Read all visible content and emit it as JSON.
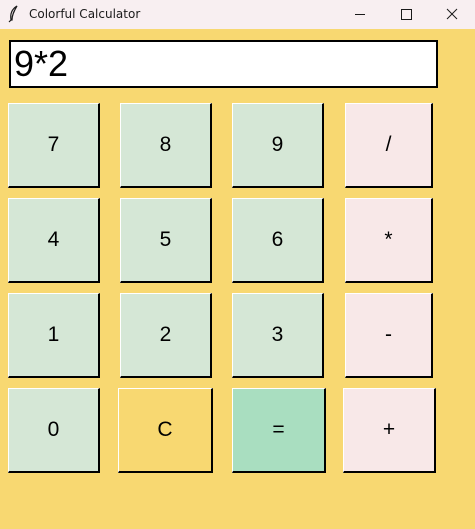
{
  "window": {
    "title": "Colorful Calculator",
    "icon": "feather-icon",
    "controls": [
      "minimize-icon",
      "maximize-icon",
      "close-icon"
    ]
  },
  "display": {
    "value": "9*2"
  },
  "keys": {
    "k7": "7",
    "k8": "8",
    "k9": "9",
    "divide": "/",
    "k4": "4",
    "k5": "5",
    "k6": "6",
    "multiply": "*",
    "k1": "1",
    "k2": "2",
    "k3": "3",
    "subtract": "-",
    "k0": "0",
    "clear": "C",
    "equals": "=",
    "add": "+"
  },
  "colors": {
    "background": "#f8d871",
    "titlebar": "#f8eff1",
    "number_key": "#d5e7d6",
    "operator_key": "#f8e8e8",
    "clear_key": "#f8d871",
    "equals_key": "#a9dec0",
    "display_bg": "#ffffff"
  }
}
